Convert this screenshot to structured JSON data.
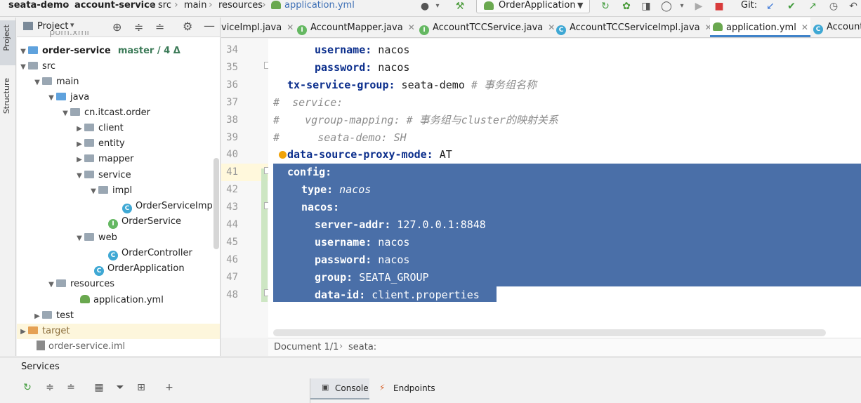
{
  "navbar": {
    "project": "seata-demo",
    "module": "account-service",
    "path1": "src",
    "path2": "main",
    "path3": "resources",
    "file": "application.yml",
    "run_config": "OrderApplication",
    "git_label": "Git:"
  },
  "left_stripe": {
    "project_tab": "Project",
    "structure_tab": "Structure"
  },
  "project_panel": {
    "title": "Project",
    "truncated_top": "pom.xml",
    "root": {
      "name": "order-service",
      "branch": "master / 4 Δ"
    },
    "items": [
      {
        "label": "src"
      },
      {
        "label": "main"
      },
      {
        "label": "java"
      },
      {
        "label": "cn.itcast.order"
      },
      {
        "label": "client"
      },
      {
        "label": "entity"
      },
      {
        "label": "mapper"
      },
      {
        "label": "service"
      },
      {
        "label": "impl"
      },
      {
        "label": "OrderServiceImpl"
      },
      {
        "label": "OrderService"
      },
      {
        "label": "web"
      },
      {
        "label": "OrderController"
      },
      {
        "label": "OrderApplication"
      },
      {
        "label": "resources"
      },
      {
        "label": "application.yml"
      },
      {
        "label": "test"
      },
      {
        "label": "target"
      },
      {
        "label": "order-service.iml"
      }
    ]
  },
  "tabs": [
    {
      "label": "viceImpl.java"
    },
    {
      "label": "AccountMapper.java"
    },
    {
      "label": "AccountTCCService.java"
    },
    {
      "label": "AccountTCCServiceImpl.java"
    },
    {
      "label": "application.yml"
    },
    {
      "label": "Account"
    }
  ],
  "editor": {
    "lines": [
      {
        "n": "34",
        "key": "username:",
        "val": " nacos"
      },
      {
        "n": "35",
        "key": "password:",
        "val": " nacos"
      },
      {
        "n": "36",
        "key": "tx-service-group:",
        "val": " seata-demo",
        "comment": " # 事务组名称"
      },
      {
        "n": "37",
        "comment": "#  service:"
      },
      {
        "n": "38",
        "comment": "#    vgroup-mapping: # 事务组与cluster的映射关系"
      },
      {
        "n": "39",
        "comment": "#      seata-demo: SH"
      },
      {
        "n": "40",
        "key": "data-source-proxy-mode:",
        "val": " AT"
      },
      {
        "n": "41",
        "key": "config:"
      },
      {
        "n": "42",
        "key": "type:",
        "val": " nacos"
      },
      {
        "n": "43",
        "key": "nacos:"
      },
      {
        "n": "44",
        "key": "server-addr:",
        "val": " 127.0.0.1:8848"
      },
      {
        "n": "45",
        "key": "username:",
        "val": " nacos"
      },
      {
        "n": "46",
        "key": "password:",
        "val": " nacos"
      },
      {
        "n": "47",
        "key": "group:",
        "val": " SEATA_GROUP"
      },
      {
        "n": "48",
        "key": "data-id:",
        "val": " client.properties"
      }
    ],
    "breadcrumb_doc": "Document 1/1",
    "breadcrumb_key": "seata:"
  },
  "services": {
    "title": "Services",
    "console_tab": "Console",
    "endpoints_tab": "Endpoints"
  }
}
